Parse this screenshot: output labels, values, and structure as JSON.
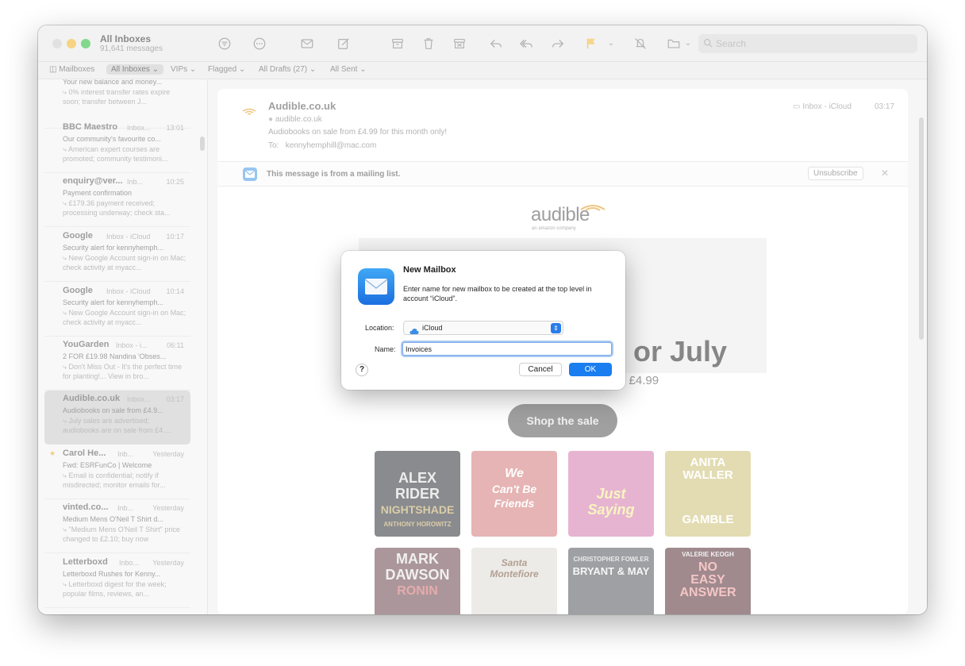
{
  "toolbar": {
    "title": "All Inboxes",
    "subtitle": "91,641 messages",
    "search_placeholder": "Search",
    "icons": [
      "filter-icon",
      "more-icon",
      "compose-new-icon",
      "compose-icon",
      "archive-icon",
      "trash-icon",
      "junk-icon",
      "reply-icon",
      "reply-all-icon",
      "forward-icon",
      "flag-icon",
      "mute-icon",
      "move-icon",
      "search-icon"
    ]
  },
  "favorites": {
    "mailboxes": "Mailboxes",
    "all_inboxes": "All Inboxes",
    "vips": "VIPs",
    "flagged": "Flagged",
    "all_drafts": "All Drafts (27)",
    "all_sent": "All Sent"
  },
  "messages": [
    {
      "sender": "",
      "mailbox": "",
      "time": "",
      "subject": "Your new balance and money...",
      "preview": "0% interest transfer rates expire soon; transfer between J..."
    },
    {
      "sender": "BBC Maestro",
      "mailbox": "Inbox...",
      "time": "13:01",
      "subject": "Our community's favourite co...",
      "preview": "American expert courses are promoted; community testimoni..."
    },
    {
      "sender": "enquiry@ver...",
      "mailbox": "Inb...",
      "time": "10:25",
      "subject": "Payment confirmation",
      "preview": "£179.36 payment received; processing underway; check sta..."
    },
    {
      "sender": "Google",
      "mailbox": "Inbox - iCloud",
      "time": "10:17",
      "subject": "Security alert for kennyhemph...",
      "preview": "New Google Account sign-in on Mac; check activity at myacc..."
    },
    {
      "sender": "Google",
      "mailbox": "Inbox - iCloud",
      "time": "10:14",
      "subject": "Security alert for kennyhemph...",
      "preview": "New Google Account sign-in on Mac; check activity at myacc..."
    },
    {
      "sender": "YouGarden",
      "mailbox": "Inbox - i...",
      "time": "06:11",
      "subject": "2 FOR £19.98 Nandina 'Obses...",
      "preview": "Don't Miss Out - It's the perfect time for planting!... View in bro..."
    },
    {
      "sender": "Audible.co.uk",
      "mailbox": "Inbox...",
      "time": "03:17",
      "subject": "Audiobooks on sale from £4.9...",
      "preview": "July sales are advertised; audiobooks are on sale from £4...."
    },
    {
      "sender": "Carol He...",
      "mailbox": "Inb...",
      "time": "Yesterday",
      "subject": "Fwd: ESRFunCo | Welcome",
      "preview": "Email is confidential; notify if misdirected; monitor emails for..."
    },
    {
      "sender": "vinted.co...",
      "mailbox": "Inb...",
      "time": "Yesterday",
      "subject": "Medium Mens O'Neil T Shirt d...",
      "preview": "\"Medium Mens O'Neil T Shirt\" price changed to £2.10; buy now"
    },
    {
      "sender": "Letterboxd",
      "mailbox": "Inbo...",
      "time": "Yesterday",
      "subject": "Letterboxd Rushes for Kenny...",
      "preview": "Letterboxd digest for the week; popular films, reviews, an..."
    }
  ],
  "reader": {
    "from": "Audible.co.uk",
    "address": "audible.co.uk",
    "subject": "Audiobooks on sale from £4.99 for this month only!",
    "to_label": "To:",
    "to": "kennyhemphill@mac.com",
    "mailbox": "Inbox - iCloud",
    "time": "03:17",
    "banner": "This message is from a mailing list.",
    "unsubscribe": "Unsubscribe"
  },
  "email": {
    "logo": "audible",
    "logo_sub": "an amazon company",
    "headline": "or July",
    "subline": "n £4.99",
    "cta": "Shop the sale",
    "covers": [
      {
        "line1": "ALEX",
        "line2": "RIDER",
        "line3": "NIGHTSHADE",
        "line4": "ANTHONY HOROWITZ"
      },
      {
        "line1": "",
        "line2": "We",
        "line3": "Can't Be",
        "line4": "Friends"
      },
      {
        "line1": "",
        "line2": "Just",
        "line3": "Saying",
        "line4": ""
      },
      {
        "line1": "ANITA",
        "line2": "WALLER",
        "line3": "GAMBLE",
        "line4": ""
      },
      {
        "line1": "MARK",
        "line2": "DAWSON",
        "line3": "RONIN",
        "line4": ""
      },
      {
        "line1": "Santa",
        "line2": "Montefiore",
        "line3": "",
        "line4": ""
      },
      {
        "line1": "CHRISTOPHER FOWLER",
        "line2": "BRYANT & MAY",
        "line3": "",
        "line4": ""
      },
      {
        "line1": "VALERIE KEOGH",
        "line2": "NO",
        "line3": "EASY",
        "line4": "ANSWER"
      }
    ]
  },
  "dialog": {
    "title": "New Mailbox",
    "message": "Enter name for new mailbox to be created at the top level in account “iCloud”.",
    "location_label": "Location:",
    "location_value": "iCloud",
    "name_label": "Name:",
    "name_value": "Invoices",
    "help": "?",
    "cancel": "Cancel",
    "ok": "OK"
  }
}
